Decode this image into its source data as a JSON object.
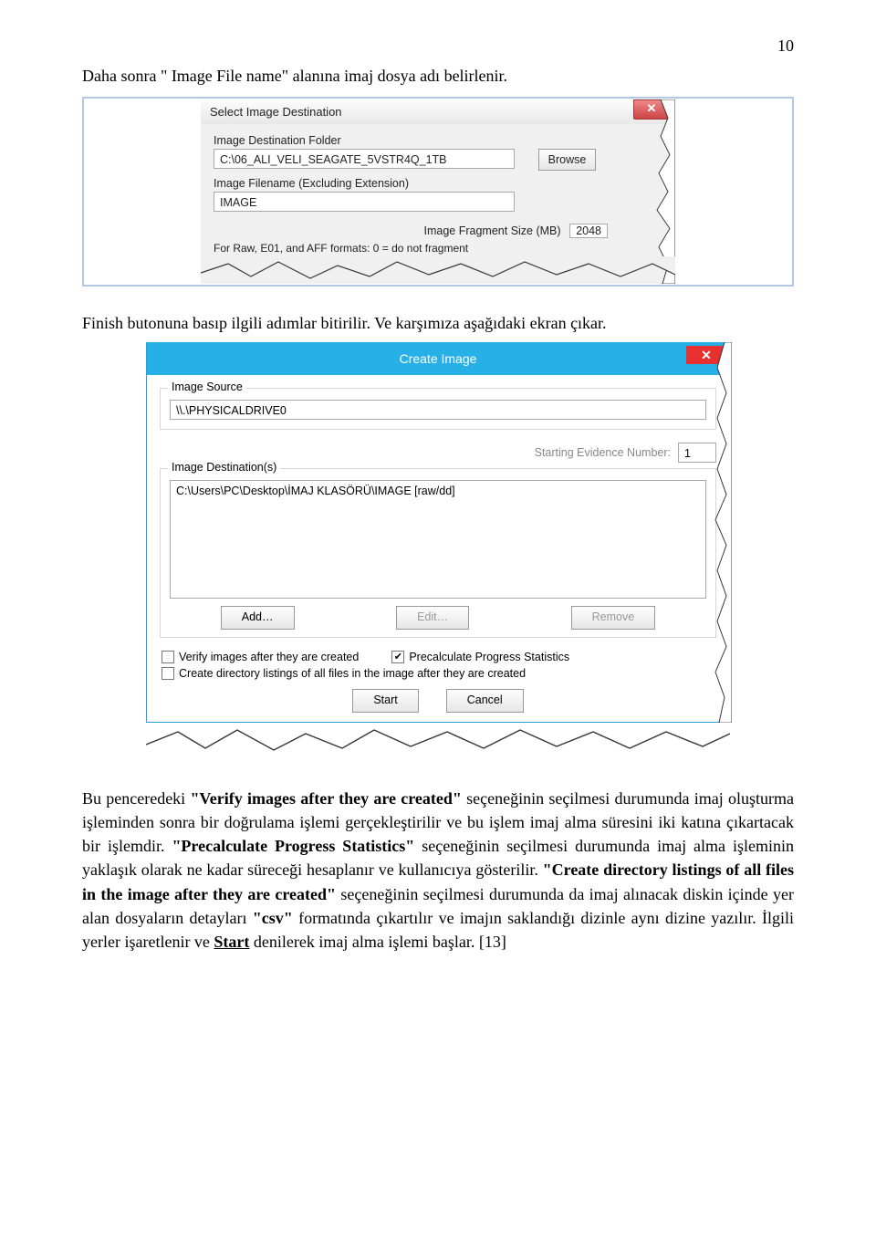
{
  "page": {
    "number": "10"
  },
  "text": {
    "intro": "Daha sonra \" Image File name\" alanına imaj dosya adı belirlenir.",
    "after_dialog1": "Finish butonuna basıp ilgili adımlar bitirilir. Ve karşımıza aşağıdaki ekran çıkar.",
    "p_lead": "Bu penceredeki ",
    "p_b1": "\"Verify images after they are created\"",
    "p_mid1": " seçeneğinin seçilmesi durumunda imaj oluşturma işleminden sonra bir doğrulama işlemi gerçekleştirilir ve bu işlem imaj alma süresini iki katına çıkartacak bir işlemdir. ",
    "p_b2": "\"Precalculate Progress Statistics\"",
    "p_mid2": " seçeneğinin seçilmesi durumunda imaj alma işleminin yaklaşık olarak ne kadar süreceği hesaplanır ve kullanıcıya gösterilir. ",
    "p_b3": "\"Create directory listings of all files in the image after they are created\"",
    "p_mid3": " seçeneğinin seçilmesi durumunda da imaj alınacak diskin içinde yer alan dosyaların detayları ",
    "p_b4": "\"csv\"",
    "p_mid4": " formatında çıkartılır ve imajın saklandığı dizinle aynı dizine yazılır. İlgili yerler işaretlenir ve ",
    "p_b5": "Start",
    "p_tail": " denilerek imaj alma işlemi başlar. [13]"
  },
  "dialog1": {
    "title": "Select Image Destination",
    "folder_label": "Image Destination Folder",
    "folder_value": "C:\\06_ALI_VELI_SEAGATE_5VSTR4Q_1TB",
    "browse": "Browse",
    "filename_label": "Image Filename (Excluding Extension)",
    "filename_value": "IMAGE",
    "fragment_label": "Image Fragment Size (MB)",
    "fragment_hint": "For Raw, E01, and AFF formats: 0 = do not fragment",
    "fragment_value": "2048"
  },
  "dialog2": {
    "title": "Create Image",
    "source_legend": "Image Source",
    "source_value": "\\\\.\\PHYSICALDRIVE0",
    "evidence_label": "Starting Evidence Number:",
    "evidence_value": "1",
    "dest_legend": "Image Destination(s)",
    "dest_value": "C:\\Users\\PC\\Desktop\\İMAJ KLASÖRÜ\\IMAGE [raw/dd]",
    "add": "Add…",
    "edit": "Edit…",
    "remove": "Remove",
    "chk_verify": "Verify images after they are created",
    "chk_precalc": "Precalculate Progress Statistics",
    "chk_dirlist": "Create directory listings of all files in the image after they are created",
    "start": "Start",
    "cancel": "Cancel"
  }
}
